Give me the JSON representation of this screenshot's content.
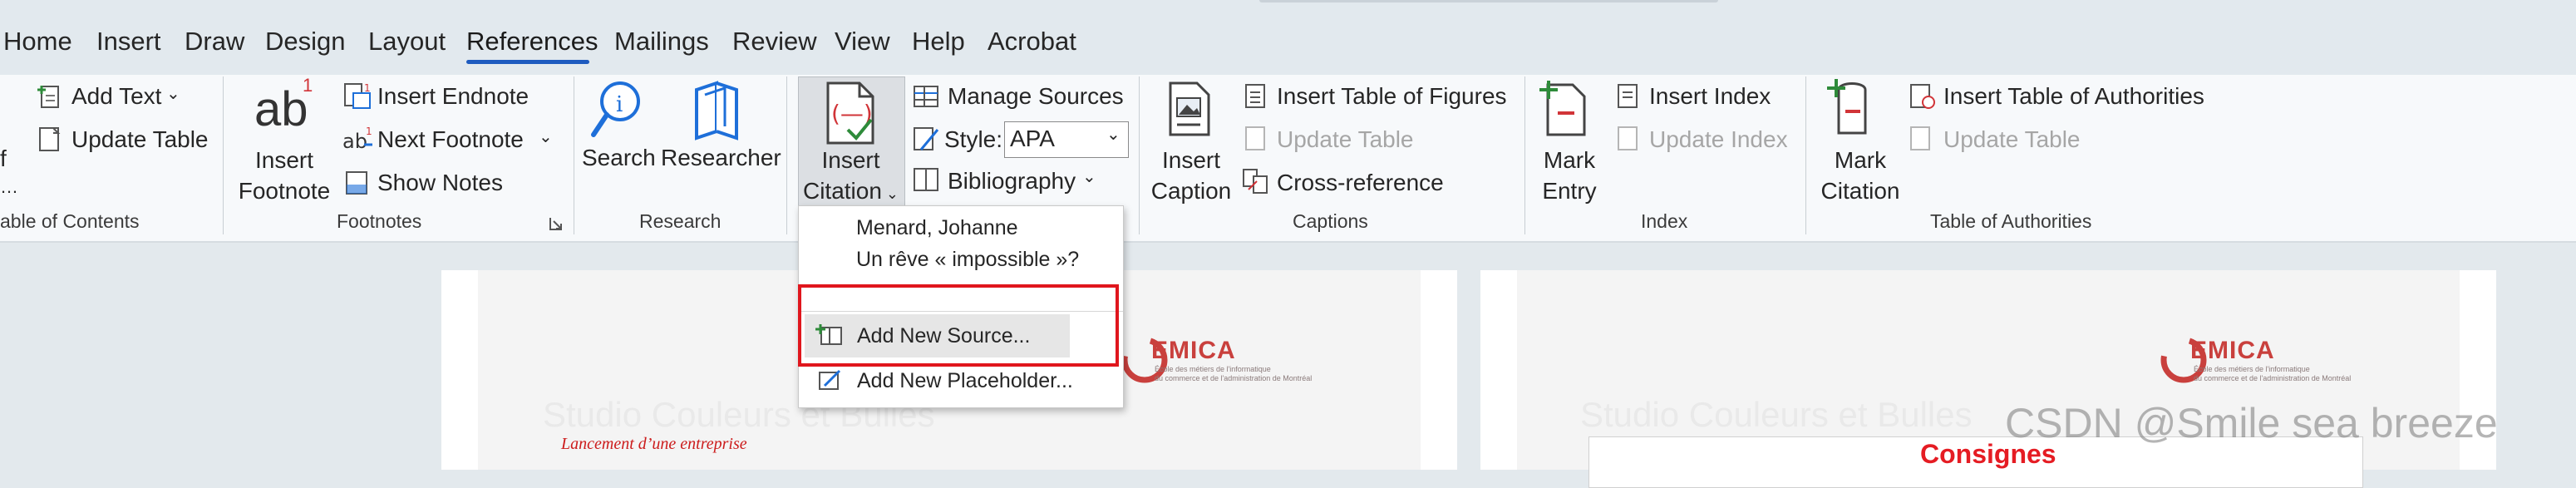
{
  "tabs": [
    "Home",
    "Insert",
    "Draw",
    "Design",
    "Layout",
    "References",
    "Mailings",
    "Review",
    "View",
    "Help",
    "Acrobat"
  ],
  "active_tab": "References",
  "toc_group": {
    "left_fragment_top": "f",
    "left_fragment_mid": "…",
    "label": "able of Contents",
    "add_text": "Add Text",
    "update_table": "Update Table"
  },
  "footnotes_group": {
    "insert_footnote_l1": "Insert",
    "insert_footnote_l2": "Footnote",
    "insert_endnote": "Insert Endnote",
    "next_footnote": "Next Footnote",
    "show_notes": "Show Notes",
    "label": "Footnotes",
    "icon_text": "ab",
    "superscript": "1"
  },
  "research_group": {
    "search": "Search",
    "researcher": "Researcher",
    "label": "Research"
  },
  "citations_group": {
    "insert_citation_l1": "Insert",
    "insert_citation_l2": "Citation",
    "manage_sources": "Manage Sources",
    "style_label": "Style:",
    "style_value": "APA",
    "bibliography": "Bibliography"
  },
  "captions_group": {
    "insert_caption_l1": "Insert",
    "insert_caption_l2": "Caption",
    "insert_table_of_figures": "Insert Table of Figures",
    "update_table": "Update Table",
    "cross_reference": "Cross-reference",
    "label": "Captions"
  },
  "index_group": {
    "mark_entry_l1": "Mark",
    "mark_entry_l2": "Entry",
    "insert_index": "Insert Index",
    "update_index": "Update Index",
    "label": "Index"
  },
  "authorities_group": {
    "mark_citation_l1": "Mark",
    "mark_citation_l2": "Citation",
    "insert_table_of_authorities": "Insert Table of Authorities",
    "update_table": "Update Table",
    "label": "Table of Authorities"
  },
  "citation_menu": {
    "source_author": "Menard, Johanne",
    "source_title": "Un rêve « impossible »?",
    "add_new_source": "Add New Source...",
    "add_new_placeholder": "Add New Placeholder..."
  },
  "document": {
    "left_ghost_title": "Studio Couleurs et Bulles",
    "right_ghost_title": "Studio Couleurs et Bulles",
    "left_subtitle": "Lancement d’une entreprise",
    "right_heading": "Consignes",
    "logo_text": "EMICA",
    "logo_sub_l1": "École des métiers de l'informatique",
    "logo_sub_l2": "du commerce et de l'administration de Montréal"
  },
  "watermark": "CSDN @Smile sea breeze",
  "colors": {
    "accent": "#1e5bbf",
    "highlight_box": "#e0161d",
    "logo_red": "#c9403d",
    "heading_red": "#e51c23"
  }
}
